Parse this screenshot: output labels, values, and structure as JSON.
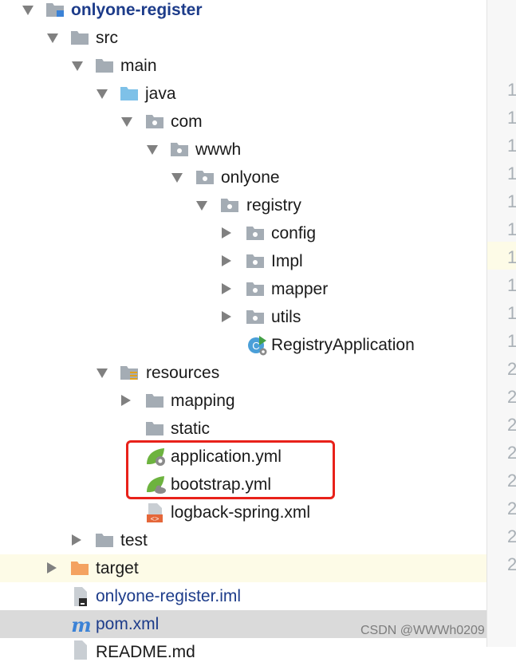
{
  "tree": {
    "project": "onlyone-register",
    "src": "src",
    "main": "main",
    "java": "java",
    "com": "com",
    "wwwh": "wwwh",
    "onlyone": "onlyone",
    "registry": "registry",
    "config": "config",
    "impl": "Impl",
    "mapper": "mapper",
    "utils": "utils",
    "registry_application": "RegistryApplication",
    "resources": "resources",
    "mapping": "mapping",
    "static": "static",
    "application_yml": "application.yml",
    "bootstrap_yml": "bootstrap.yml",
    "logback": "logback-spring.xml",
    "test": "test",
    "target": "target",
    "iml": "onlyone-register.iml",
    "pom": "pom.xml",
    "readme": "README.md"
  },
  "gutter": {
    "lines": [
      "1",
      "1",
      "1",
      "1",
      "1",
      "1",
      "1",
      "1",
      "1",
      "1",
      "2",
      "2",
      "2",
      "2",
      "2",
      "2",
      "2",
      "2"
    ]
  },
  "watermark": "CSDN @WWWh0209",
  "colors": {
    "folder": "#a4acb4",
    "source_folder": "#7ec1e8",
    "target_folder": "#f4a261",
    "spring_green": "#6db33f",
    "highlight_box": "#e8211a",
    "project_text": "#1d3c8a"
  }
}
